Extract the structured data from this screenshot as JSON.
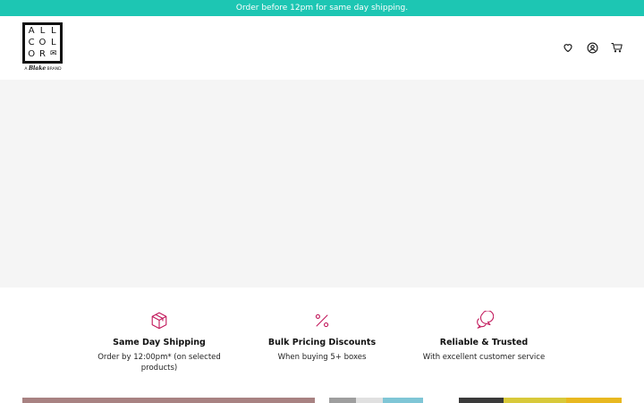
{
  "announcement": "Order before 12pm for same day shipping.",
  "logo": {
    "letters": [
      "A",
      "L",
      "L",
      "C",
      "O",
      "L",
      "O",
      "R",
      "✉"
    ],
    "brand_prefix": "A",
    "brand_name": "Blake",
    "brand_suffix": "BRAND"
  },
  "header_icons": [
    "heart-icon",
    "user-icon",
    "cart-icon"
  ],
  "features": [
    {
      "icon": "box-icon",
      "title": "Same Day Shipping",
      "text": "Order by 12:00pm* (on selected products)"
    },
    {
      "icon": "percent-icon",
      "title": "Bulk Pricing Discounts",
      "text": "When buying 5+ boxes"
    },
    {
      "icon": "chat-icon",
      "title": "Reliable & Trusted",
      "text": "With excellent customer service"
    }
  ],
  "colors": {
    "announcement_bg": "#1dc6b3",
    "feature_icon": "#c2185b",
    "hero_bg": "#f5f5f5",
    "strip_left": "#a88282",
    "strip_right": [
      "#9e9e9e",
      "#e0e0e0",
      "#7fc6d6",
      "#ffffff",
      "#3a3a3a",
      "#d8c93a",
      "#e8b820"
    ]
  }
}
